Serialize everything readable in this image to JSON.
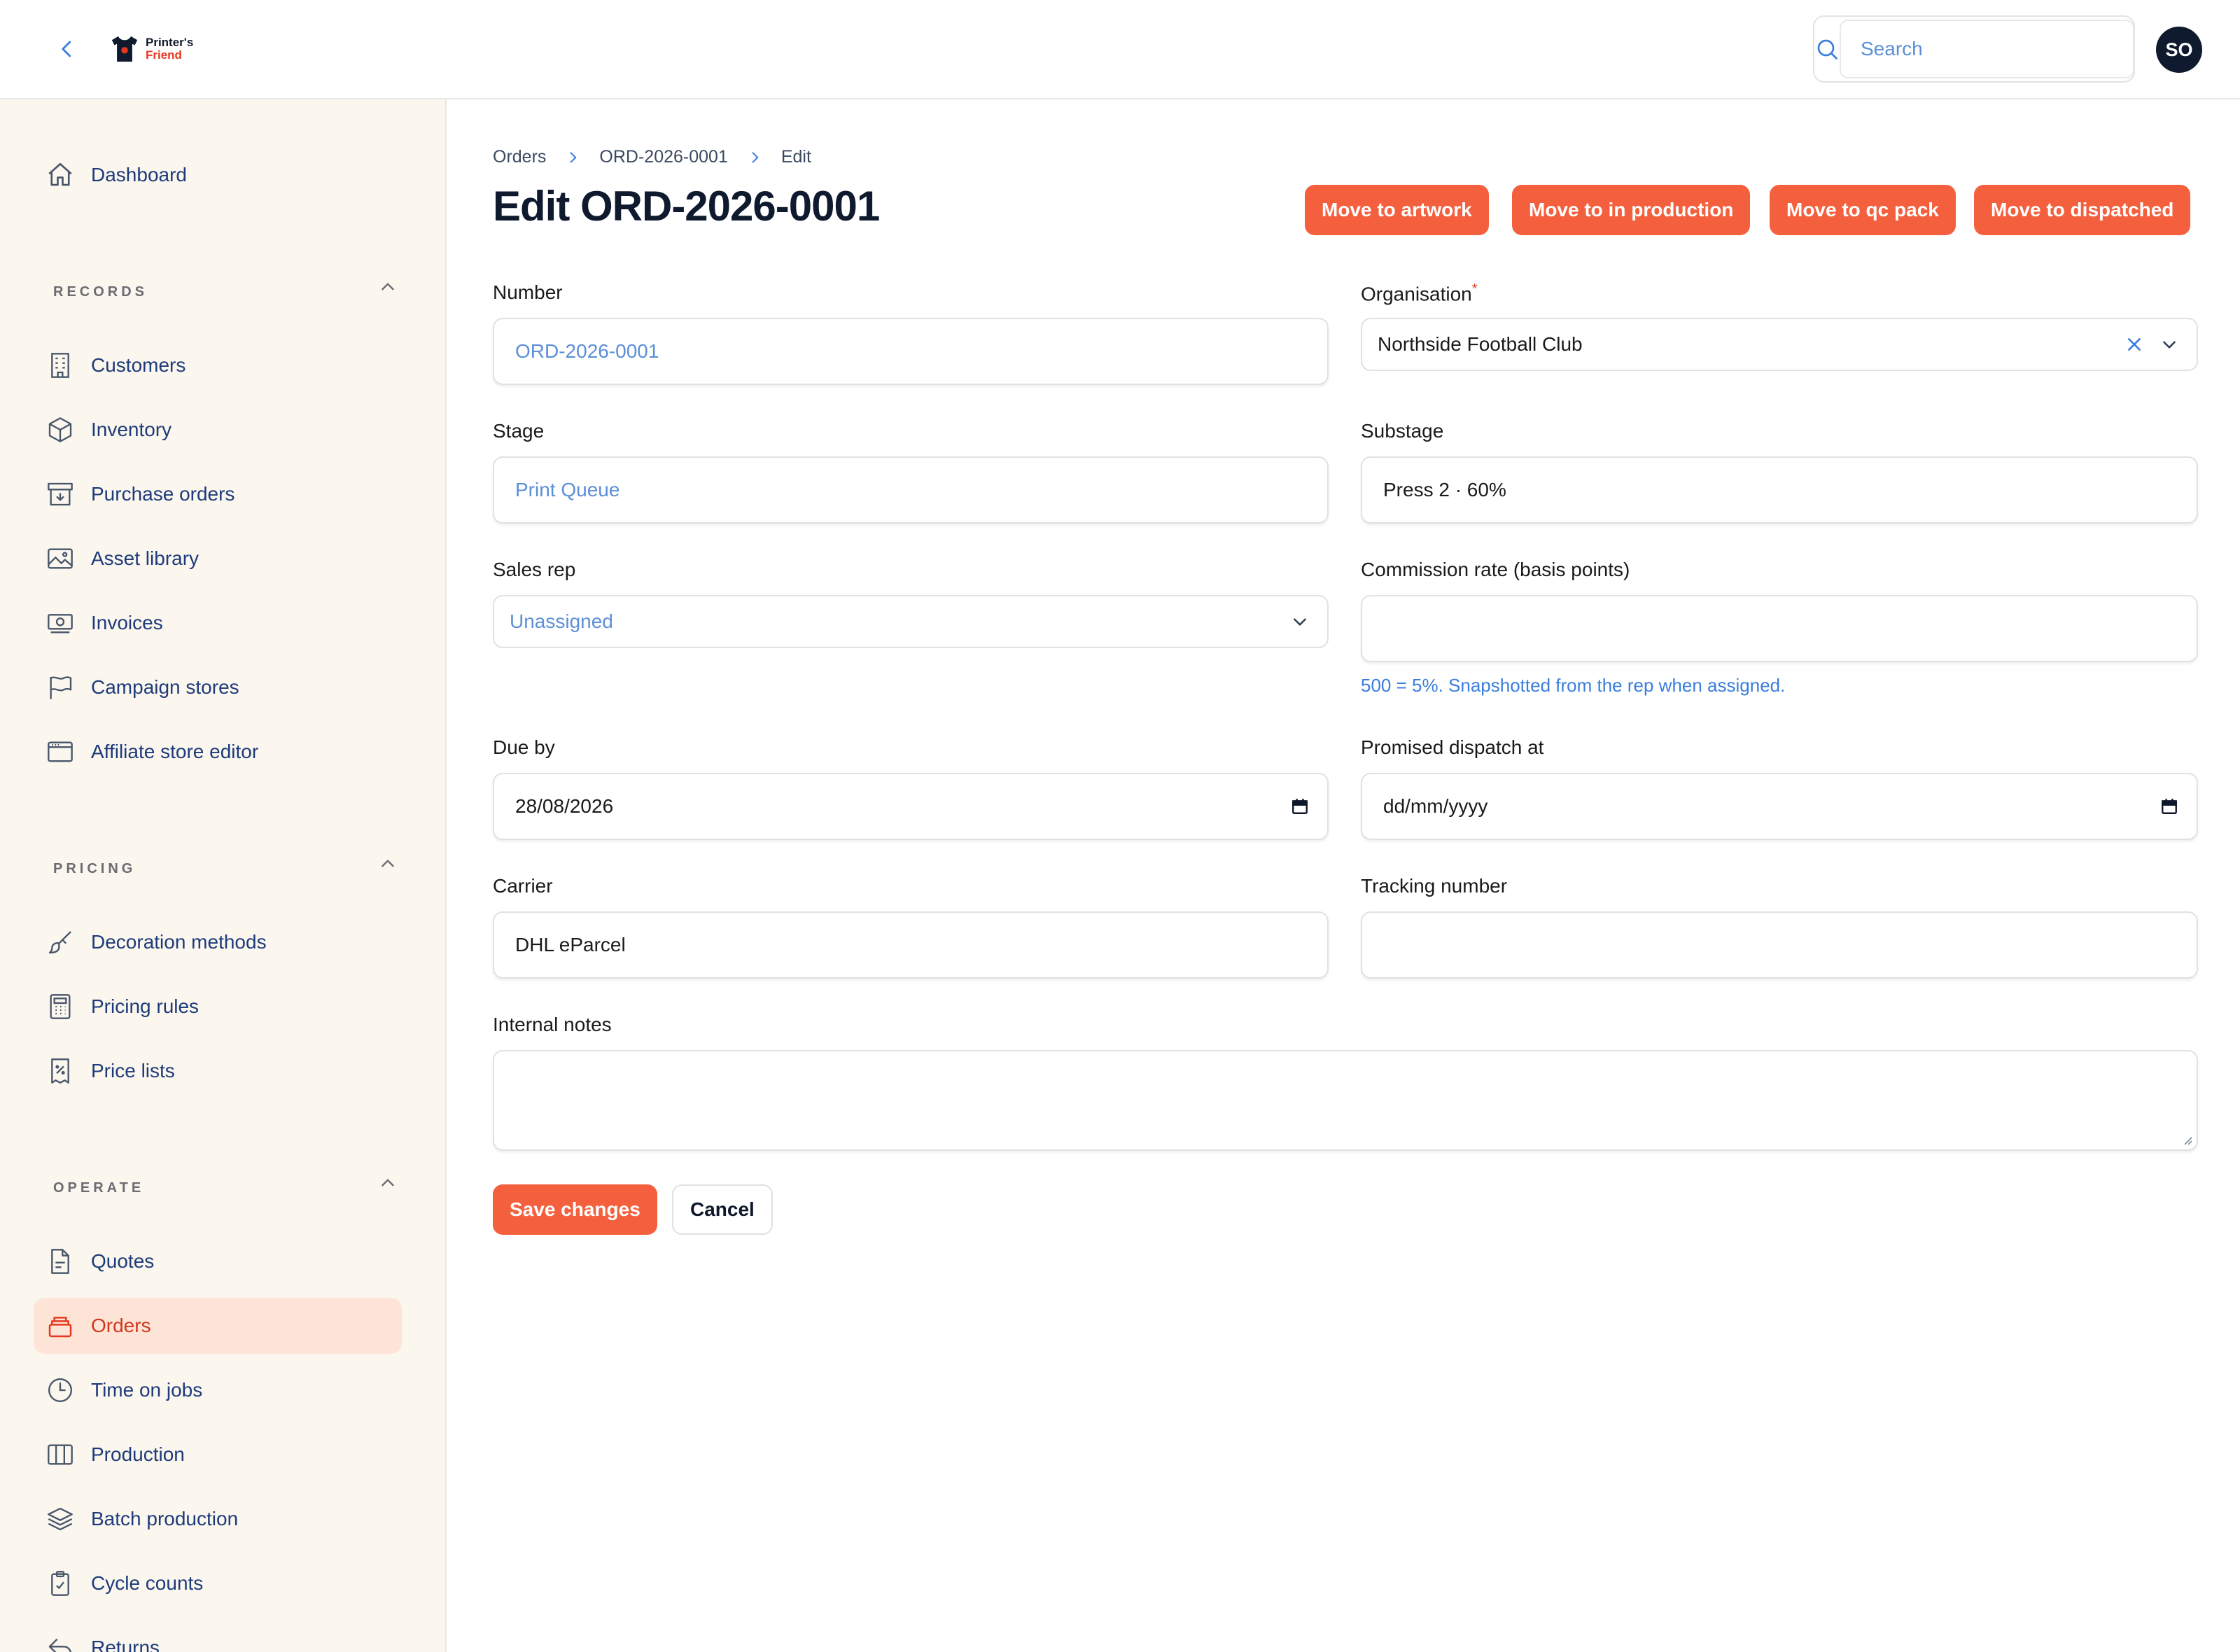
{
  "app": {
    "logo_line1": "Printer's",
    "logo_line2": "Friend",
    "search_placeholder": "Search",
    "avatar_initials": "SO"
  },
  "sidebar": {
    "dashboard": "Dashboard",
    "sections": [
      {
        "title": "RECORDS",
        "items": [
          "Customers",
          "Inventory",
          "Purchase orders",
          "Asset library",
          "Invoices",
          "Campaign stores",
          "Affiliate store editor"
        ]
      },
      {
        "title": "PRICING",
        "items": [
          "Decoration methods",
          "Pricing rules",
          "Price lists"
        ]
      },
      {
        "title": "OPERATE",
        "items": [
          "Quotes",
          "Orders",
          "Time on jobs",
          "Production",
          "Batch production",
          "Cycle counts",
          "Returns"
        ]
      }
    ],
    "active_item": "Orders"
  },
  "breadcrumb": [
    "Orders",
    "ORD-2026-0001",
    "Edit"
  ],
  "page_title": "Edit ORD-2026-0001",
  "actions": [
    "Move to artwork",
    "Move to in production",
    "Move to qc pack",
    "Move to dispatched"
  ],
  "form": {
    "number": {
      "label": "Number",
      "value": "ORD-2026-0001"
    },
    "organisation": {
      "label": "Organisation",
      "required_mark": "*",
      "value": "Northside Football Club"
    },
    "stage": {
      "label": "Stage",
      "value": "Print Queue"
    },
    "substage": {
      "label": "Substage",
      "value": "Press 2 · 60%"
    },
    "sales_rep": {
      "label": "Sales rep",
      "value": "Unassigned"
    },
    "commission": {
      "label": "Commission rate (basis points)",
      "value": "",
      "hint": "500 = 5%. Snapshotted from the rep when assigned."
    },
    "due_by": {
      "label": "Due by",
      "value": "28/08/2026"
    },
    "promised_dispatch": {
      "label": "Promised dispatch at",
      "value": "dd/mm/yyyy"
    },
    "carrier": {
      "label": "Carrier",
      "value": "DHL eParcel"
    },
    "tracking": {
      "label": "Tracking number",
      "value": ""
    },
    "notes": {
      "label": "Internal notes",
      "value": ""
    }
  },
  "buttons": {
    "save": "Save changes",
    "cancel": "Cancel"
  },
  "colors": {
    "accent": "#f4603e",
    "nav_text": "#1d3b7a",
    "active_bg": "#fde4d6",
    "link_blue": "#3b7ddd"
  }
}
